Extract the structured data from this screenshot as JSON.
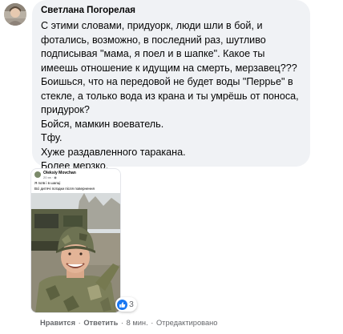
{
  "comment": {
    "author": "Светлана Погорелая",
    "lines": [
      "С этими словами, придуорк, люди шли в бой, и",
      "фотались, возможно, в последний раз, шутливо",
      "подписывая \"мама, я поел и в шапке\". Какое ты",
      "имеешь отношение к идущим на смерть, мерзавец???",
      "Боишься, что на передовой не будет воды \"Перрье\" в",
      "стекле, а только вода из крана и ты умрёшь от поноса,",
      "придурок?",
      "Бойся, мамкин воеватель.",
      "Тфу.",
      "Хуже раздавленного таракана.",
      "Более мерзко."
    ]
  },
  "attached_post": {
    "author": "Oleksiy Movchan",
    "time": "20 хв · ◉",
    "text1": "Я поїв і в шапці",
    "text2": "Всі дитячі поїздки після повернення"
  },
  "reactions": {
    "count": "3",
    "icon": "like-icon",
    "color": "#1877f2"
  },
  "actions": {
    "like": "Нравится",
    "reply": "Ответить",
    "time": "8 мин.",
    "edited": "Отредактировано",
    "separator": "·"
  },
  "colors": {
    "bubble_bg": "#f0f2f5",
    "text": "#050505",
    "secondary": "#65676b"
  }
}
